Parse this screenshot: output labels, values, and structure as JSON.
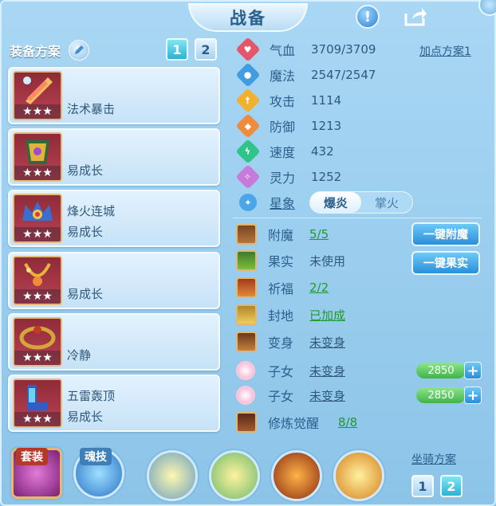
{
  "title": "战备",
  "left": {
    "heading": "装备方案",
    "tabs": [
      "1",
      "2"
    ],
    "plans": [
      {
        "line1": "",
        "line2": "法术暴击",
        "stars": "★★★"
      },
      {
        "line1": "",
        "line2": "易成长",
        "stars": "★★★"
      },
      {
        "line1": "烽火连城",
        "line2": "易成长",
        "stars": "★★★"
      },
      {
        "line1": "",
        "line2": "易成长",
        "stars": "★★★"
      },
      {
        "line1": "",
        "line2": "冷静",
        "stars": "★★★"
      },
      {
        "line1": "五雷轰顶",
        "line2": "易成长",
        "stars": "★★★"
      }
    ]
  },
  "stats": {
    "add_point_plan": "加点方案1",
    "items": [
      {
        "label": "气血",
        "value": "3709/3709",
        "color": "#e4576b"
      },
      {
        "label": "魔法",
        "value": "2547/2547",
        "color": "#3f9de0"
      },
      {
        "label": "攻击",
        "value": "1114",
        "color": "#f2b02f"
      },
      {
        "label": "防御",
        "value": "1213",
        "color": "#f08a3c"
      },
      {
        "label": "速度",
        "value": "432",
        "color": "#2fc48a"
      },
      {
        "label": "灵力",
        "value": "1252",
        "color": "#c77adb"
      }
    ],
    "star_label": "星象",
    "star_options": [
      "爆炎",
      "掌火"
    ]
  },
  "extras": {
    "enchant": {
      "label": "附魔",
      "value": "5/5"
    },
    "fruit": {
      "label": "果实",
      "value": "未使用"
    },
    "blessing": {
      "label": "祈福",
      "value": "2/2"
    },
    "seal": {
      "label": "封地",
      "value": "已加成"
    },
    "transform": {
      "label": "变身",
      "value": "未变身"
    },
    "child1": {
      "label": "子女",
      "value": "未变身",
      "points": "2850"
    },
    "child2": {
      "label": "子女",
      "value": "未变身",
      "points": "2850"
    },
    "awaken": {
      "label": "修炼觉醒",
      "value": "8/8"
    },
    "btn_enchant": "一键附魔",
    "btn_fruit": "一键果实"
  },
  "bottom": {
    "suit_label": "套装",
    "soul_label": "魂技",
    "mount_label": "坐骑方案",
    "mount_tabs": [
      "1",
      "2"
    ]
  }
}
